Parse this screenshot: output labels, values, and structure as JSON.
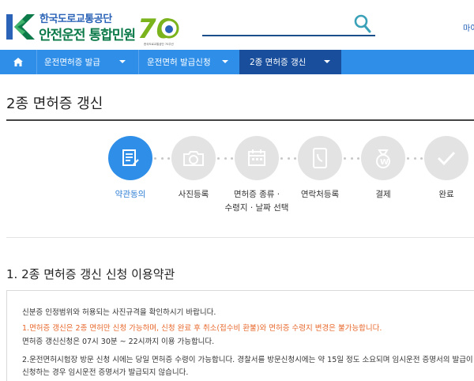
{
  "header": {
    "org_name": "한국도로교통공단",
    "service_name": "안전운전 통합민원",
    "anniversary_number": "70",
    "anniversary_caption": "한국도로교통공단 70주년",
    "top_right_text": "마이",
    "search_placeholder": ""
  },
  "nav": {
    "items": [
      {
        "label": "운전면허증 발급"
      },
      {
        "label": "운전면허 발급신청"
      },
      {
        "label": "2종 면허증 갱신"
      }
    ]
  },
  "page": {
    "title": "2종 면허증 갱신"
  },
  "steps": [
    {
      "label": "약관동의",
      "active": true
    },
    {
      "label": "사진등록",
      "active": false
    },
    {
      "label": "면허증 종류 ·\n수령지 · 날짜 선택",
      "active": false
    },
    {
      "label": "연락처등록",
      "active": false
    },
    {
      "label": "결제",
      "active": false
    },
    {
      "label": "완료",
      "active": false
    }
  ],
  "section": {
    "title": "1. 2종 면허증 갱신 신청 이용약관"
  },
  "terms": {
    "line1": "신분증 인정범위와 허용되는 사진규격을 확인하시기 바랍니다.",
    "line2": "1.면허증 갱신은 2종 면허만 신청 가능하며, 신청 완료 후 취소(접수비 환불)와 면허증 수령지 변경은 불가능합니다.",
    "line3": "면허증 갱신신청은 07시 30분 ~ 22시까지 이용 가능합니다.",
    "line4": "2.운전면허시험장 방문 신청 시에는 당일 면허증 수령이 가능합니다. 경찰서를 방문신청시에는 약 15일 정도 소요되며 임시운전 증명서의 발급이 가",
    "line5": "신청하는 경우 임시운전 증명서가 발급되지 않습니다."
  },
  "colors": {
    "nav_bg": "#2f8fe8",
    "nav_active_bg": "#184e9b",
    "brand_blue": "#2a63b7",
    "brand_green": "#0d7a4a",
    "step_active": "#2f8fe8",
    "step_inactive": "#e3e3e3",
    "notice_red": "#e8672b"
  }
}
